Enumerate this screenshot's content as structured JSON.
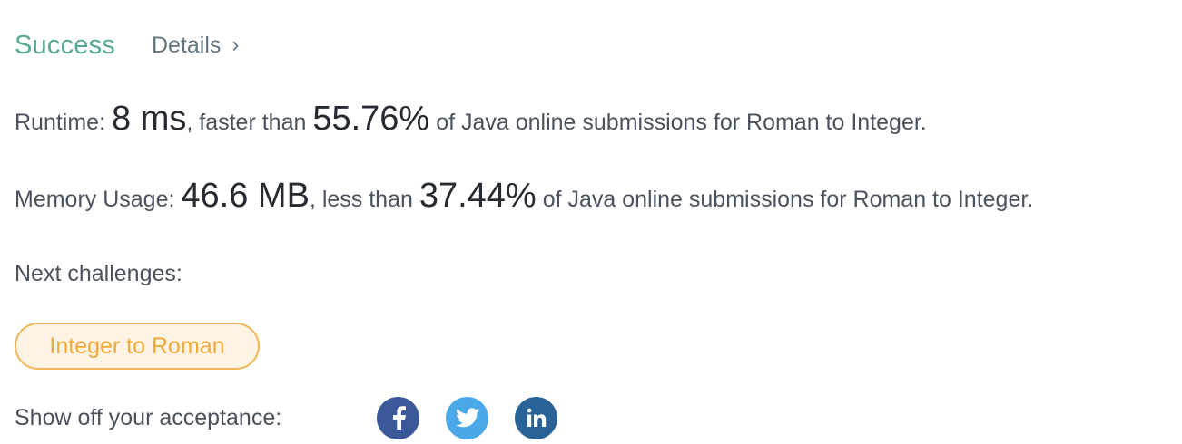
{
  "header": {
    "status": "Success",
    "details_label": "Details",
    "details_chevron": "›"
  },
  "runtime": {
    "label": "Runtime:",
    "value": "8 ms",
    "middle": ", faster than",
    "percent": "55.76%",
    "suffix": "of Java online submissions for Roman to Integer."
  },
  "memory": {
    "label": "Memory Usage:",
    "value": "46.6 MB",
    "middle": ", less than",
    "percent": "37.44%",
    "suffix": "of Java online submissions for Roman to Integer."
  },
  "next": {
    "label": "Next challenges:",
    "challenges": [
      "Integer to Roman"
    ]
  },
  "share": {
    "label": "Show off your acceptance:",
    "icons": [
      "facebook-icon",
      "twitter-icon",
      "linkedin-icon"
    ]
  },
  "colors": {
    "success": "#57a996",
    "pill_border": "#f0b75a",
    "pill_bg": "#fdf3e2",
    "pill_text": "#efa93a",
    "facebook": "#3b5998",
    "twitter": "#4aa8e8",
    "linkedin": "#2a6295"
  }
}
